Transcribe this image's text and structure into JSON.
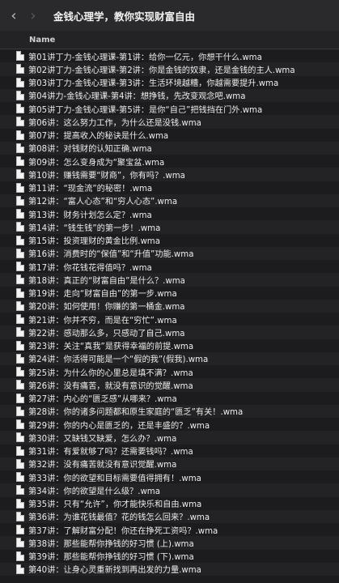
{
  "window": {
    "title": "金钱心理学，教你实现财富自由",
    "back_icon": "chevron-left-icon",
    "forward_icon": "chevron-right-icon"
  },
  "columns": {
    "name": "Name"
  },
  "files": [
    "第01讲丁力-金钱心理课-第1讲：给你一亿元，你想干什么.wma",
    "第02讲丁力-金钱心理课-第2讲：你是金钱的奴隶，还是金钱的主人.wma",
    "第03讲丁力-金钱心理课-第3讲：生活环境越糟，你越需要提升.wma",
    "第04讲力-金钱心理课-第4讲：想挣钱，先改变观念吧.wma",
    "第05讲丁力-金钱心理课-第5讲：是你“自己”把钱挡在门外.wma",
    "第06讲：这么努力工作，为什么还是没钱.wma",
    "第07讲：提高收入的秘诀是什么.wma",
    "第08讲：对钱财的认知正确.wma",
    "第09讲：怎么变身成为“聚宝盆.wma",
    "第10讲：赚钱需要“财商”，你有吗？.wma",
    "第11讲：“现金流”的秘密！.wma",
    "第12讲：“富人心态”和“穷人心态”.wma",
    "第13讲：财务计划怎么定？.wma",
    "第14讲：“钱生钱”的第一步！.wma",
    "第15讲：投资理财的黄金比例.wma",
    "第16讲：消费时的“保值”和“升值”功能.wma",
    "第17讲：你花钱花得值吗？.wma",
    "第18讲：真正的“财富自由”是什么？.wma",
    "第19讲：走向“财富自由”的第一步.wma",
    "第20讲：如何使用！你赚的第一桶金.wma",
    "第21讲：你并不穷，而是在“穷忙”.wma",
    "第22讲：感动那么多，只感动了自己.wma",
    "第23讲：关注“真我”是获得幸福的前提.wma",
    "第24讲：你活得可能是一个“假的我”(假我).wma",
    "第25讲：为什么你的心里总是填不满？.wma",
    "第26讲：没有痛苦，就没有意识的觉醒.wma",
    "第27讲：内心的“匮乏感”从哪来？.wma",
    "第28讲：你的诸多问题都和原生家庭的“匮乏”有关！.wma",
    "第29讲：你的内心是匮乏的，还是丰盛的？.wma",
    "第30讲：又缺钱又缺爱，怎么办？.wma",
    "第31讲：有爱就够了吗？还需要钱吗？.wma",
    "第32讲：没有痛苦就没有意识觉醒.wma",
    "第33讲：你的欲望和目标需要值得拥有！.wma",
    "第34讲：你的欲望是什么级？.wma",
    "第35讲：只有“允许”，你才能快乐和自由.wma",
    "第36讲：为谁花钱最值？花的钱怎么回来？.wma",
    "第37讲：了解财富分配！你还在挣死工资吗？.wma",
    "第38讲：那些能帮你挣钱的好习惯 (上).wma",
    "第39讲：那些能帮你挣钱的好习惯 (下).wma",
    "第40讲：让身心灵重新找到再出发的力量.wma"
  ]
}
